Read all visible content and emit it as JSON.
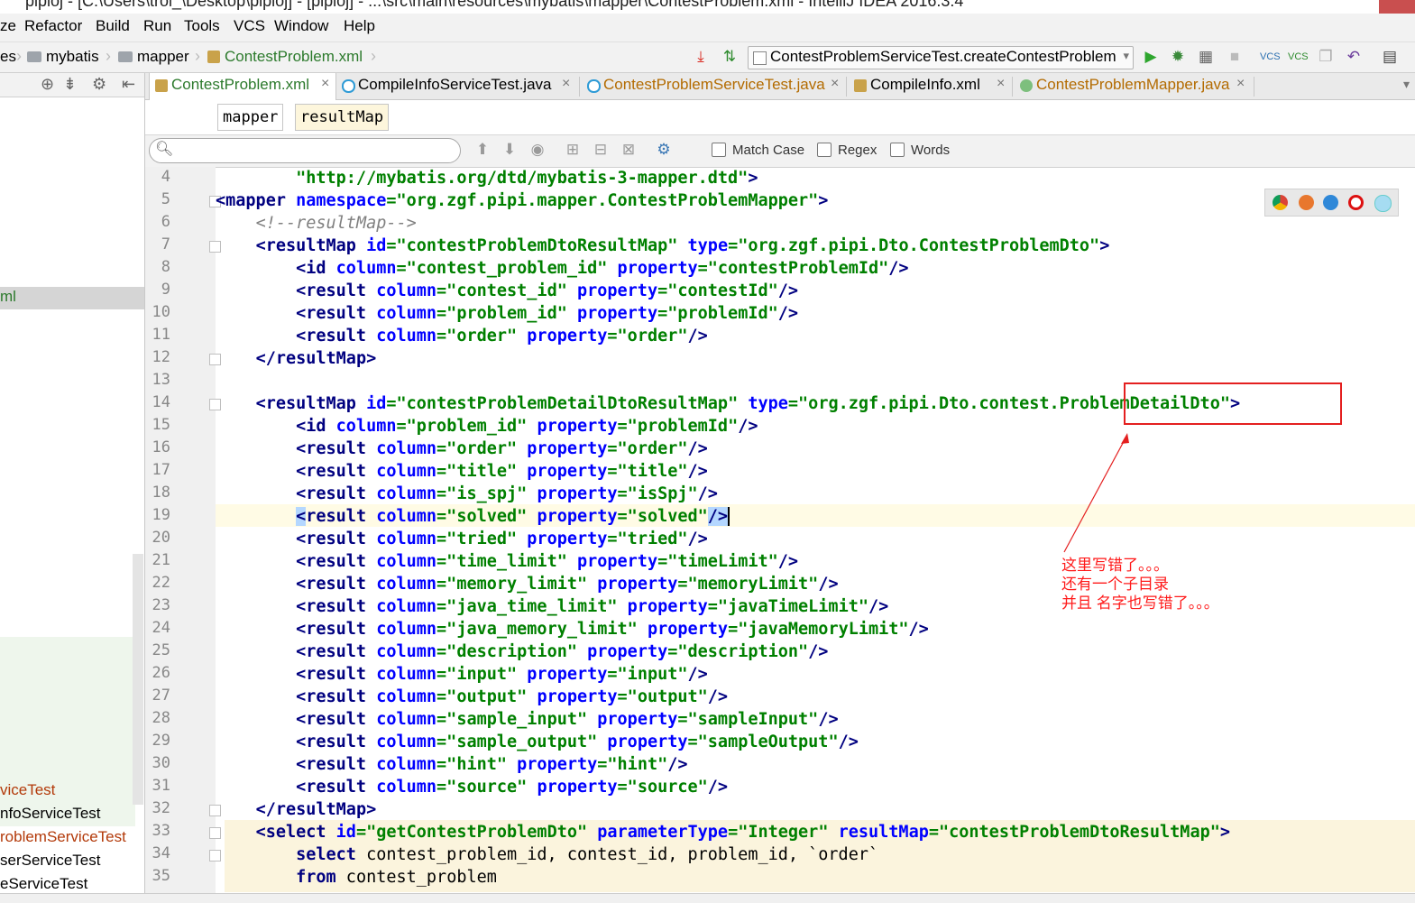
{
  "window": {
    "title": "pipioj - [C:\\Users\\trol_\\Desktop\\pipioj] - [pipioj] - ...\\src\\main\\resources\\mybatis\\mapper\\ContestProblem.xml - IntelliJ IDEA 2016.3.4"
  },
  "menu": {
    "items": [
      "ze",
      "Refactor",
      "Build",
      "Run",
      "Tools",
      "VCS",
      "Window",
      "Help"
    ]
  },
  "navbar": {
    "crumbs": [
      "es",
      "mybatis",
      "mapper",
      "ContestProblem.xml"
    ],
    "run_config": "ContestProblemServiceTest.createContestProblem"
  },
  "tabs": [
    {
      "label": "ContestProblem.xml",
      "active": true,
      "color": "#2c7a2c"
    },
    {
      "label": "CompileInfoServiceTest.java",
      "active": false,
      "color": "#000000"
    },
    {
      "label": "ContestProblemServiceTest.java",
      "active": false,
      "color": "#b36b00"
    },
    {
      "label": "CompileInfo.xml",
      "active": false,
      "color": "#000000"
    },
    {
      "label": "ContestProblemMapper.java",
      "active": false,
      "color": "#b36b00"
    }
  ],
  "editor_crumbs": [
    "mapper",
    "resultMap"
  ],
  "search": {
    "placeholder": "",
    "options": [
      "Match Case",
      "Regex",
      "Words"
    ]
  },
  "left_panel": {
    "selected_item": "ml",
    "items": [
      "viceTest",
      "nfoServiceTest",
      "roblemServiceTest",
      "serServiceTest",
      "eServiceTest"
    ]
  },
  "lines": [
    {
      "n": "4",
      "html": "        <span class='v'>\"http://mybatis.org/dtd/mybatis-3-mapper.dtd\"</span><span class='k'>&gt;</span>"
    },
    {
      "n": "5",
      "html": "<span class='k'>&lt;mapper </span><span class='a'>namespace</span><span class='v'>=\"org.zgf.pipi.mapper.ContestProblemMapper\"</span><span class='k'>&gt;</span>"
    },
    {
      "n": "6",
      "html": "    <span class='c'>&lt;!--resultMap--&gt;</span>"
    },
    {
      "n": "7",
      "html": "    <span class='k'>&lt;resultMap </span><span class='a'>id</span><span class='v'>=\"contestProblemDtoResultMap\"</span> <span class='a'>type</span><span class='v'>=\"org.zgf.pipi.Dto.ContestProblemDto\"</span><span class='k'>&gt;</span>"
    },
    {
      "n": "8",
      "html": "        <span class='k'>&lt;id </span><span class='a'>column</span><span class='v'>=\"contest_problem_id\"</span> <span class='a'>property</span><span class='v'>=\"contestProblemId\"</span><span class='k'>/&gt;</span>"
    },
    {
      "n": "9",
      "html": "        <span class='k'>&lt;result </span><span class='a'>column</span><span class='v'>=\"contest_id\"</span> <span class='a'>property</span><span class='v'>=\"contestId\"</span><span class='k'>/&gt;</span>"
    },
    {
      "n": "10",
      "html": "        <span class='k'>&lt;result </span><span class='a'>column</span><span class='v'>=\"problem_id\"</span> <span class='a'>property</span><span class='v'>=\"problemId\"</span><span class='k'>/&gt;</span>"
    },
    {
      "n": "11",
      "html": "        <span class='k'>&lt;result </span><span class='a'>column</span><span class='v'>=\"order\"</span> <span class='a'>property</span><span class='v'>=\"order\"</span><span class='k'>/&gt;</span>"
    },
    {
      "n": "12",
      "html": "    <span class='k'>&lt;/resultMap&gt;</span>"
    },
    {
      "n": "13",
      "html": ""
    },
    {
      "n": "14",
      "html": "    <span class='k'>&lt;resultMap </span><span class='a'>id</span><span class='v'>=\"contestProblemDetailDtoResultMap\"</span> <span class='a'>type</span><span class='v'>=\"org.zgf.pipi.Dto.contest.ProblemDetailDto\"</span><span class='k'>&gt;</span>"
    },
    {
      "n": "15",
      "html": "        <span class='k'>&lt;id </span><span class='a'>column</span><span class='v'>=\"problem_id\"</span> <span class='a'>property</span><span class='v'>=\"problemId\"</span><span class='k'>/&gt;</span>"
    },
    {
      "n": "16",
      "html": "        <span class='k'>&lt;result </span><span class='a'>column</span><span class='v'>=\"order\"</span> <span class='a'>property</span><span class='v'>=\"order\"</span><span class='k'>/&gt;</span>"
    },
    {
      "n": "17",
      "html": "        <span class='k'>&lt;result </span><span class='a'>column</span><span class='v'>=\"title\"</span> <span class='a'>property</span><span class='v'>=\"title\"</span><span class='k'>/&gt;</span>"
    },
    {
      "n": "18",
      "html": "        <span class='k'>&lt;result </span><span class='a'>column</span><span class='v'>=\"is_spj\"</span> <span class='a'>property</span><span class='v'>=\"isSpj\"</span><span class='k'>/&gt;</span>"
    },
    {
      "n": "19",
      "html": "        <span class='k' style='background:#b4d7ff'>&lt;</span><span class='k'>result </span><span class='a'>column</span><span class='v'>=\"solved\"</span> <span class='a'>property</span><span class='v'>=\"solved\"</span><span class='k' style='background:#b4d7ff'>/&gt;</span><span style='border-left:2px solid #000'></span>"
    },
    {
      "n": "20",
      "html": "        <span class='k'>&lt;result </span><span class='a'>column</span><span class='v'>=\"tried\"</span> <span class='a'>property</span><span class='v'>=\"tried\"</span><span class='k'>/&gt;</span>"
    },
    {
      "n": "21",
      "html": "        <span class='k'>&lt;result </span><span class='a'>column</span><span class='v'>=\"time_limit\"</span> <span class='a'>property</span><span class='v'>=\"timeLimit\"</span><span class='k'>/&gt;</span>"
    },
    {
      "n": "22",
      "html": "        <span class='k'>&lt;result </span><span class='a'>column</span><span class='v'>=\"memory_limit\"</span> <span class='a'>property</span><span class='v'>=\"memoryLimit\"</span><span class='k'>/&gt;</span>"
    },
    {
      "n": "23",
      "html": "        <span class='k'>&lt;result </span><span class='a'>column</span><span class='v'>=\"java_time_limit\"</span> <span class='a'>property</span><span class='v'>=\"javaTimeLimit\"</span><span class='k'>/&gt;</span>"
    },
    {
      "n": "24",
      "html": "        <span class='k'>&lt;result </span><span class='a'>column</span><span class='v'>=\"java_memory_limit\"</span> <span class='a'>property</span><span class='v'>=\"javaMemoryLimit\"</span><span class='k'>/&gt;</span>"
    },
    {
      "n": "25",
      "html": "        <span class='k'>&lt;result </span><span class='a'>column</span><span class='v'>=\"description\"</span> <span class='a'>property</span><span class='v'>=\"description\"</span><span class='k'>/&gt;</span>"
    },
    {
      "n": "26",
      "html": "        <span class='k'>&lt;result </span><span class='a'>column</span><span class='v'>=\"input\"</span> <span class='a'>property</span><span class='v'>=\"input\"</span><span class='k'>/&gt;</span>"
    },
    {
      "n": "27",
      "html": "        <span class='k'>&lt;result </span><span class='a'>column</span><span class='v'>=\"output\"</span> <span class='a'>property</span><span class='v'>=\"output\"</span><span class='k'>/&gt;</span>"
    },
    {
      "n": "28",
      "html": "        <span class='k'>&lt;result </span><span class='a'>column</span><span class='v'>=\"sample_input\"</span> <span class='a'>property</span><span class='v'>=\"sampleInput\"</span><span class='k'>/&gt;</span>"
    },
    {
      "n": "29",
      "html": "        <span class='k'>&lt;result </span><span class='a'>column</span><span class='v'>=\"sample_output\"</span> <span class='a'>property</span><span class='v'>=\"sampleOutput\"</span><span class='k'>/&gt;</span>"
    },
    {
      "n": "30",
      "html": "        <span class='k'>&lt;result </span><span class='a'>column</span><span class='v'>=\"hint\"</span> <span class='a'>property</span><span class='v'>=\"hint\"</span><span class='k'>/&gt;</span>"
    },
    {
      "n": "31",
      "html": "        <span class='k'>&lt;result </span><span class='a'>column</span><span class='v'>=\"source\"</span> <span class='a'>property</span><span class='v'>=\"source\"</span><span class='k'>/&gt;</span>"
    },
    {
      "n": "32",
      "html": "    <span class='k'>&lt;/resultMap&gt;</span>"
    },
    {
      "n": "33",
      "html": "    <span class='k'>&lt;select </span><span class='a'>id</span><span class='v'>=\"getContestProblemDto\"</span> <span class='a'>parameterType</span><span class='v'>=\"Integer\"</span> <span class='a'>resultMap</span><span class='v'>=\"contestProblemDtoResultMap\"</span><span class='k'>&gt;</span>"
    },
    {
      "n": "34",
      "html": "        <span class='kw'>select</span> contest_problem_id, contest_id, problem_id, `order`"
    },
    {
      "n": "35",
      "html": "        <span class='kw'>from</span> contest_problem"
    }
  ],
  "annotation": {
    "text": "这里写错了。。。\n还有一个子目录\n并且 名字也写错了。。。",
    "color": "#e41f1f"
  }
}
